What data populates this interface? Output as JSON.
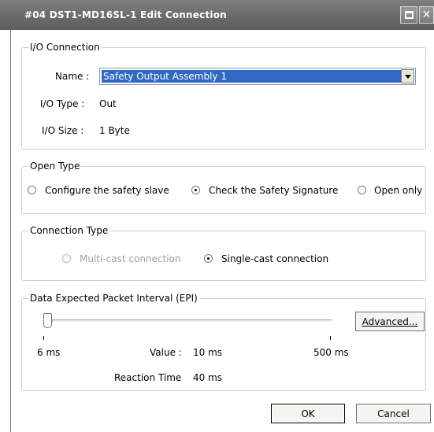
{
  "window": {
    "title": "#04 DST1-MD16SL-1 Edit Connection"
  },
  "io_connection": {
    "legend": "I/O Connection",
    "name_label": "Name :",
    "name_value": "Safety Output Assembly 1",
    "io_type_label": "I/O Type :",
    "io_type_value": "Out",
    "io_size_label": "I/O Size :",
    "io_size_value": "1 Byte"
  },
  "open_type": {
    "legend": "Open Type",
    "options": [
      {
        "label": "Configure the safety slave",
        "selected": false
      },
      {
        "label": "Check the Safety Signature",
        "selected": true
      },
      {
        "label": "Open only",
        "selected": false
      }
    ]
  },
  "connection_type": {
    "legend": "Connection Type",
    "options": [
      {
        "label": "Multi-cast connection",
        "selected": false,
        "enabled": false
      },
      {
        "label": "Single-cast connection",
        "selected": true,
        "enabled": true
      }
    ]
  },
  "epi": {
    "legend": "Data Expected Packet Interval (EPI)",
    "advanced_label": "Advanced...",
    "min_label": "6 ms",
    "max_label": "500 ms",
    "value_label": "Value :",
    "value_text": "10 ms",
    "reaction_label": "Reaction Time",
    "reaction_text": "40 ms",
    "slider_value_ms": 10,
    "slider_min_ms": 6,
    "slider_max_ms": 500
  },
  "footer": {
    "ok_label": "OK",
    "cancel_label": "Cancel"
  }
}
